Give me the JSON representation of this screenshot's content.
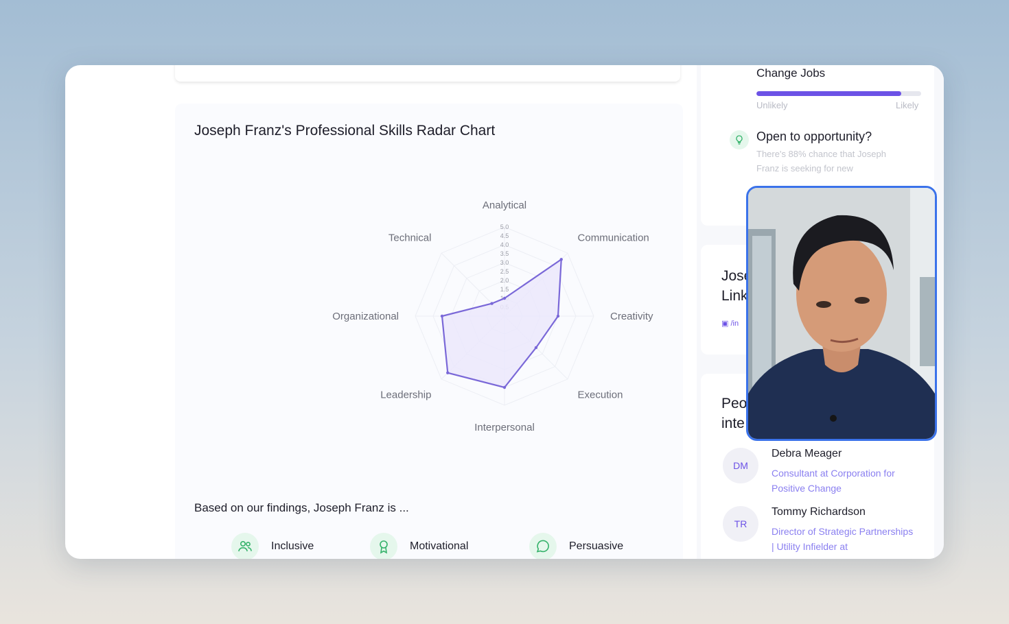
{
  "chart": {
    "title": "Joseph Franz's Professional Skills Radar Chart",
    "findings": "Based on our findings, Joseph Franz is ..."
  },
  "chart_data": {
    "type": "radar",
    "title": "Joseph Franz's Professional Skills Radar Chart",
    "axes": [
      "Analytical",
      "Communication",
      "Creativity",
      "Execution",
      "Interpersonal",
      "Leadership",
      "Organizational",
      "Technical"
    ],
    "values": [
      1.0,
      4.5,
      3.0,
      2.5,
      4.0,
      4.5,
      3.5,
      1.0
    ],
    "scale_ticks": [
      "5.0",
      "4.5",
      "4.0",
      "3.5",
      "3.0",
      "2.5",
      "2.0",
      "1.5",
      "1.0",
      "0.5"
    ],
    "range": [
      0,
      5
    ],
    "fill_color": "#ebe8fb",
    "stroke_color": "#7a68d8"
  },
  "traits": [
    {
      "label": "Inclusive",
      "icon": "people-icon"
    },
    {
      "label": "Motivational",
      "icon": "award-icon"
    },
    {
      "label": "Persuasive",
      "icon": "chat-bubble-icon"
    }
  ],
  "sidebar": {
    "change_jobs": {
      "title": "Change Jobs",
      "progress": 0.88,
      "low_label": "Unlikely",
      "high_label": "Likely"
    },
    "open_to_opportunity": {
      "title": "Open to opportunity?",
      "description": "There's 88% chance that Joseph Franz is seeking for new"
    },
    "linkedin_card": {
      "line1": "Jose",
      "line2": "Link",
      "tag": "/in"
    },
    "people": {
      "line1": "Peo",
      "line2": "inte",
      "list": [
        {
          "initials": "DM",
          "name": "Debra Meager",
          "title": "Consultant at Corporation for Positive Change"
        },
        {
          "initials": "TR",
          "name": "Tommy Richardson",
          "title": "Director of Strategic Partnerships | Utility Infielder at"
        }
      ]
    }
  },
  "colors": {
    "accent": "#6c52e6",
    "green": "#34b26a",
    "video_border": "#3a72ea"
  }
}
